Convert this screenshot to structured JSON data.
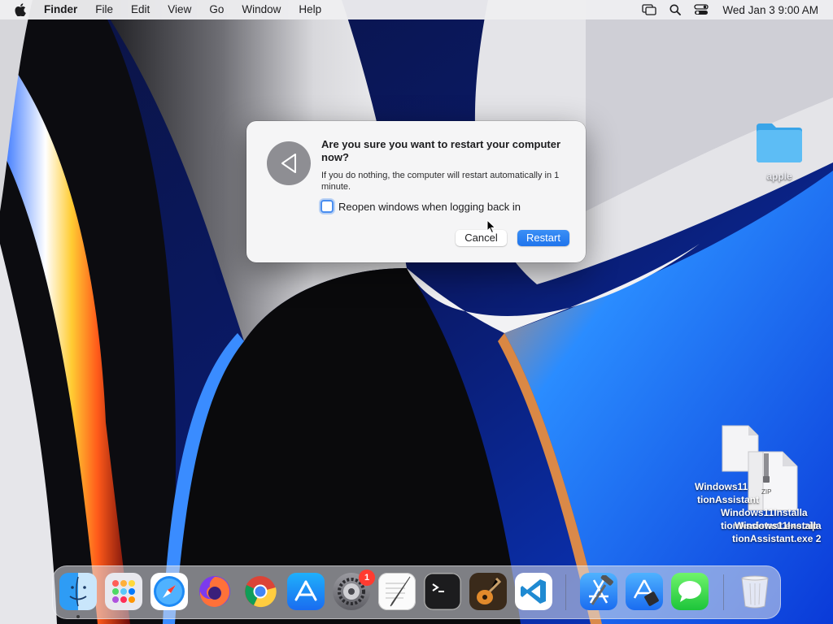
{
  "menubar": {
    "app_name": "Finder",
    "menus": [
      "File",
      "Edit",
      "View",
      "Go",
      "Window",
      "Help"
    ],
    "clock": "Wed Jan 3  9:00 AM",
    "status_icons": [
      "screen-mirroring-icon",
      "spotlight-search-icon",
      "control-center-icon"
    ]
  },
  "dialog": {
    "title": "Are you sure you want to restart your computer now?",
    "message": "If you do nothing, the computer will restart automatically in 1 minute.",
    "checkbox_label": "Reopen windows when logging back in",
    "checkbox_checked": false,
    "cancel_label": "Cancel",
    "restart_label": "Restart",
    "icon": "restart-triangle-icon"
  },
  "desktop": {
    "folder_label": "apple",
    "file1_label_line1": "Windows11",
    "file1_label_line2": "tionAssistant",
    "file2_label_line1": "Windows11Installa",
    "file2_label_line2": "tionAssistant.exe.zip",
    "file3_label_line1": "Windows11Installa",
    "file3_label_line2": "tionAssistant.exe 2",
    "zip_badge": "ZIP"
  },
  "dock": {
    "apps": [
      "Finder",
      "Launchpad",
      "Safari",
      "Firefox",
      "Chrome",
      "App Store",
      "System Settings",
      "TextEdit",
      "Terminal",
      "GarageBand",
      "Visual Studio Code",
      "Xcode",
      "Simulator",
      "Messages",
      "Trash"
    ],
    "settings_badge": "1"
  },
  "colors": {
    "accent": "#1f74ec",
    "checkbox_focus": "#4a8ef0"
  }
}
